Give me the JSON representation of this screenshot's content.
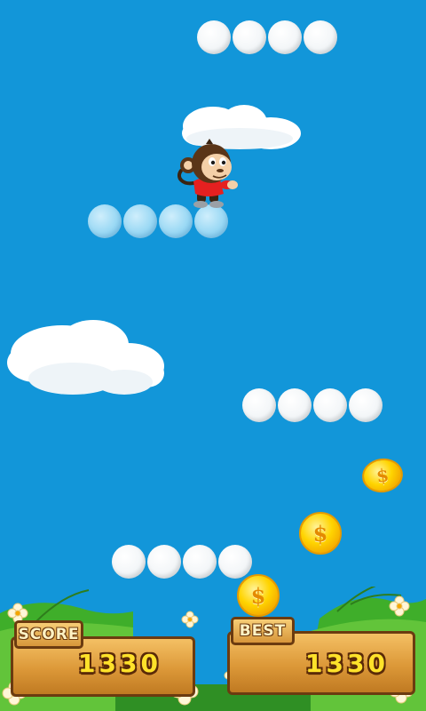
{
  "hud": {
    "score_label": "SCORE",
    "score_value": "1330",
    "best_label": "BEST",
    "best_value": "1330"
  },
  "coin_symbol": "$",
  "colors": {
    "sky": "#1296d9",
    "platform_white": "#f3f6f8",
    "platform_blue": "#99d8f4",
    "coin_gold": "#ffd400",
    "wood": "#dc9838",
    "score_digits": "#ffe22a",
    "grass": "#3fae2a"
  },
  "icons": {
    "player": "monkey-character",
    "coin": "gold-dollar-coin",
    "platform": "cloud-ball-platform"
  }
}
